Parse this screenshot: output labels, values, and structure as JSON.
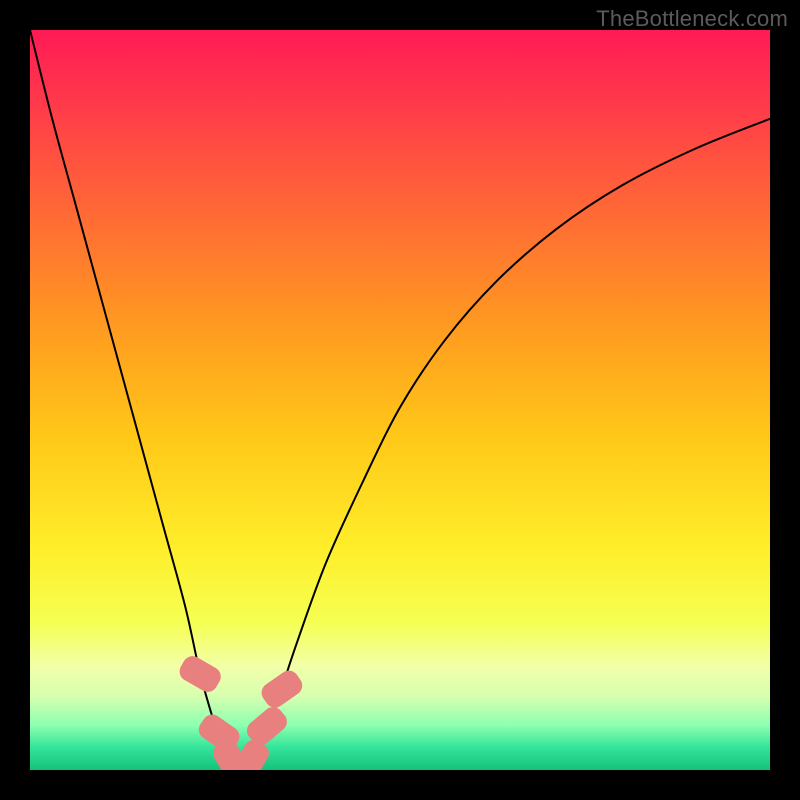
{
  "watermark": "TheBottleneck.com",
  "colors": {
    "black": "#000000",
    "curve": "#000000",
    "marker": "#e98080"
  },
  "chart_data": {
    "type": "line",
    "title": "",
    "xlabel": "",
    "ylabel": "",
    "xlim": [
      0,
      100
    ],
    "ylim": [
      0,
      100
    ],
    "gradient_stops": [
      {
        "offset": 0.0,
        "color": "#ff1a55"
      },
      {
        "offset": 0.1,
        "color": "#ff3a4a"
      },
      {
        "offset": 0.25,
        "color": "#ff6a35"
      },
      {
        "offset": 0.4,
        "color": "#ff9a20"
      },
      {
        "offset": 0.55,
        "color": "#ffc818"
      },
      {
        "offset": 0.7,
        "color": "#ffee2a"
      },
      {
        "offset": 0.8,
        "color": "#f5ff52"
      },
      {
        "offset": 0.86,
        "color": "#f2ffa8"
      },
      {
        "offset": 0.9,
        "color": "#d7ffb0"
      },
      {
        "offset": 0.94,
        "color": "#8cffb0"
      },
      {
        "offset": 0.97,
        "color": "#33e49a"
      },
      {
        "offset": 1.0,
        "color": "#16c27a"
      }
    ],
    "series": [
      {
        "name": "bottleneck-curve",
        "x": [
          0,
          3,
          6,
          9,
          12,
          15,
          18,
          21,
          23,
          25,
          26,
          27,
          28,
          29,
          30,
          31,
          33,
          36,
          40,
          45,
          50,
          56,
          63,
          71,
          80,
          90,
          100
        ],
        "y": [
          100,
          88,
          77,
          66,
          55,
          44,
          33,
          22,
          13,
          6,
          3,
          1,
          0,
          0,
          1,
          3,
          8,
          17,
          28,
          39,
          49,
          58,
          66,
          73,
          79,
          84,
          88
        ]
      }
    ],
    "markers": [
      {
        "x": 23.0,
        "y": 13.0,
        "w": 3.5,
        "h": 5.5,
        "rot": -60
      },
      {
        "x": 25.5,
        "y": 5.0,
        "w": 3.5,
        "h": 5.5,
        "rot": -55
      },
      {
        "x": 27.0,
        "y": 1.5,
        "w": 3.5,
        "h": 5.0,
        "rot": -30
      },
      {
        "x": 30.0,
        "y": 1.5,
        "w": 3.5,
        "h": 5.0,
        "rot": 30
      },
      {
        "x": 32.0,
        "y": 6.0,
        "w": 3.5,
        "h": 5.5,
        "rot": 50
      },
      {
        "x": 34.0,
        "y": 11.0,
        "w": 3.5,
        "h": 5.5,
        "rot": 55
      }
    ]
  }
}
